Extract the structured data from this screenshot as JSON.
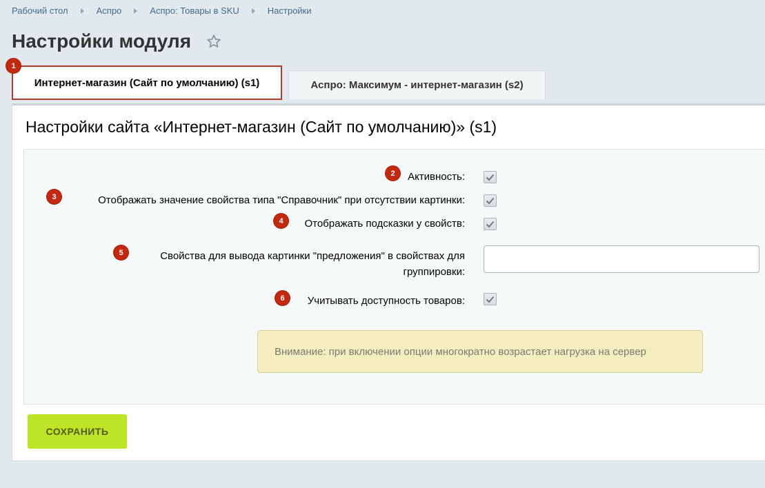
{
  "breadcrumb": [
    "Рабочий стол",
    "Аспро",
    "Аспро: Товары в SKU",
    "Настройки"
  ],
  "page": {
    "title": "Настройки модуля"
  },
  "tabs": [
    {
      "label": "Интернет-магазин (Сайт по умолчанию) (s1)",
      "badge": "1",
      "active": true
    },
    {
      "label": "Аспро: Максимум - интернет-магазин (s2)",
      "active": false
    }
  ],
  "panel": {
    "title": "Настройки сайта «Интернет-магазин (Сайт по умолчанию)» (s1)",
    "options": [
      {
        "badge": "2",
        "label": "Активность:",
        "checked": true
      },
      {
        "badge": "3",
        "label": "Отображать значение свойства типа \"Справочник\" при отсутствии картинки:",
        "checked": true
      },
      {
        "badge": "4",
        "label": "Отображать подсказки у свойств:",
        "checked": true
      },
      {
        "badge": "5",
        "label_line1": "Свойства для вывода картинки \"предложения\" в свойствах для",
        "label_line2": "группировки:",
        "value": ""
      },
      {
        "badge": "6",
        "label": "Учитывать доступность товаров:",
        "checked": true
      }
    ],
    "warning": "Внимание: при включении опции многократно возрастает нагрузка на сервер",
    "save_label": "СОХРАНИТЬ"
  },
  "colors": {
    "accent_badge": "#c4280e",
    "save_button": "#bde427",
    "warning_bg": "#f3edbf"
  },
  "icons": [
    "star-icon",
    "breadcrumb-arrow-icon",
    "checkmark-icon"
  ]
}
